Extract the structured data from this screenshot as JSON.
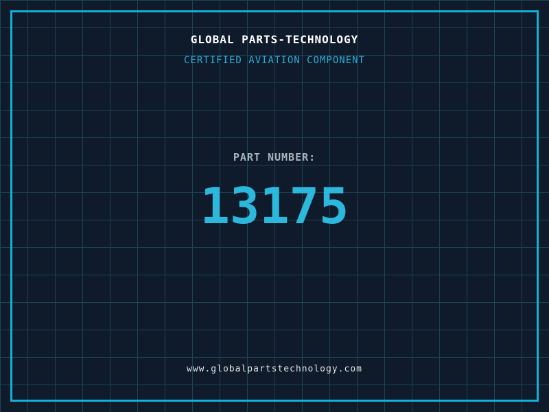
{
  "header": {
    "company_name": "GLOBAL PARTS-TECHNOLOGY",
    "tagline": "CERTIFIED AVIATION COMPONENT"
  },
  "part": {
    "label": "PART NUMBER:",
    "number": "13175"
  },
  "footer": {
    "website": "www.globalpartstechnology.com"
  },
  "colors": {
    "background": "#0f1a2b",
    "grid_line": "#1c4355",
    "frame": "#12b1d8",
    "title": "#ffffff",
    "tagline": "#2ab0d5",
    "label": "#aab4bd",
    "part_number": "#2cb7dc",
    "website": "#dfe3e6"
  }
}
